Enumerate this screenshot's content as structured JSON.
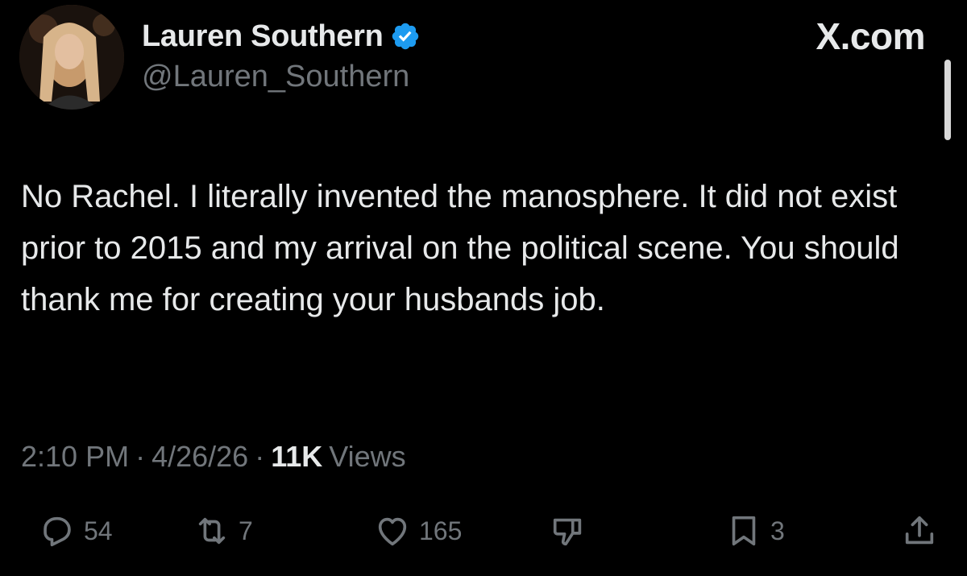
{
  "header": {
    "author_name": "Lauren Southern",
    "author_handle": "@Lauren_Southern",
    "site_label": "X.com",
    "verified_icon": "verified-badge-icon",
    "accent_color": "#1d9bf0"
  },
  "tweet": {
    "text": "No Rachel. I literally invented the manosphere. It did not exist prior to 2015 and my arrival on the political scene. You should thank me for creating your husbands job."
  },
  "meta": {
    "time": "2:10 PM",
    "separator": "·",
    "date": "4/26/26",
    "views_count": "11K",
    "views_label": "Views"
  },
  "actions": {
    "reply": {
      "icon": "reply-icon",
      "count": "54"
    },
    "repost": {
      "icon": "repost-icon",
      "count": "7"
    },
    "like": {
      "icon": "heart-icon",
      "count": "165"
    },
    "dislike": {
      "icon": "thumbs-down-icon"
    },
    "bookmark": {
      "icon": "bookmark-icon",
      "count": "3"
    },
    "share": {
      "icon": "share-icon"
    }
  },
  "colors": {
    "background": "#000000",
    "primary_text": "#e7e9ea",
    "secondary_text": "#71767b"
  }
}
